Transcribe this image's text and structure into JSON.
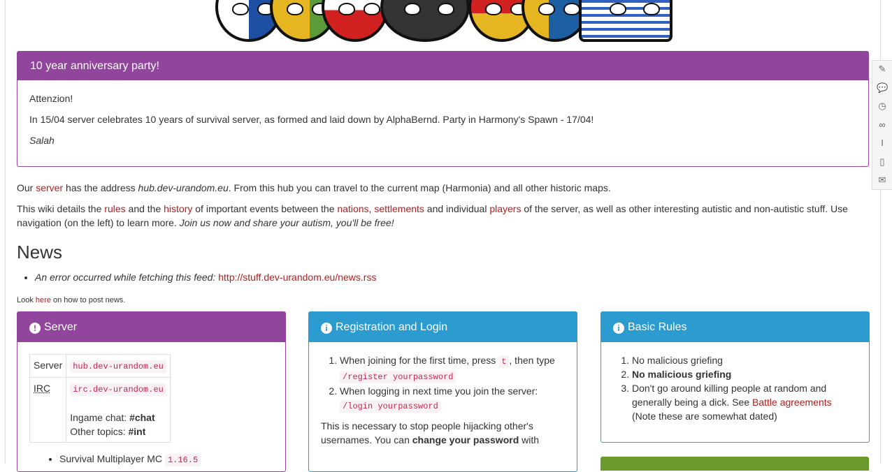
{
  "notice": {
    "title": "10 year anniversary party!",
    "line1": "Attenzion!",
    "line2": "In 15/04 server celebrates 10 years of survival server, as formed and laid down by AlphaBernd. Party in Harmony's Spawn - 17/04!",
    "signature": "Salah"
  },
  "intro": {
    "p1_a": "Our ",
    "p1_link": "server",
    "p1_b": " has the address ",
    "p1_address": "hub.dev-urandom.eu",
    "p1_c": ". From this hub you can travel to the current map (Harmonia) and all other historic maps.",
    "p2_a": "This wiki details the ",
    "p2_rules": "rules",
    "p2_b": " and the ",
    "p2_history": "history",
    "p2_c": " of important events between the ",
    "p2_nations": "nations",
    "p2_d": ", ",
    "p2_settlements": "settlements",
    "p2_e": " and individual ",
    "p2_players": "players",
    "p2_f": " of the server, as well as other interesting autistic and non-autistic stuff. Use navigation (on the left) to learn more. ",
    "p2_italic": "Join us now and share your autism, you'll be free!"
  },
  "news": {
    "heading": "News",
    "error_text": "An error occurred while fetching this feed: ",
    "feed_url": "http://stuff.dev-urandom.eu/news.rss",
    "howto_a": "Look ",
    "howto_link": "here",
    "howto_b": " on how to post news."
  },
  "server_box": {
    "title": "Server",
    "row1_label": "Server",
    "row1_value": "hub.dev-urandom.eu",
    "row2_label": "IRC",
    "row2_value": "irc.dev-urandom.eu",
    "ingame_label": "Ingame chat: ",
    "ingame_value": "#chat",
    "other_label": "Other topics: ",
    "other_value": "#int",
    "list_item": "Survival Multiplayer MC ",
    "version": "1.16.5"
  },
  "registration_box": {
    "title": "Registration and Login",
    "step1_a": "When joining for the first time, press ",
    "step1_key": "t",
    "step1_b": ", then type",
    "step1_cmd": "/register yourpassword",
    "step2": "When logging in next time you join the server:",
    "step2_cmd": "/login yourpassword",
    "note_a": "This is necessary to stop people hijacking other's usernames. You can ",
    "note_bold": "change your password",
    "note_b": " with"
  },
  "rules_box": {
    "title": "Basic Rules",
    "rule1": "No malicious griefing",
    "rule2": "No malicious griefing",
    "rule3_a": "Don't go around killing people at random and generally being a dick. See ",
    "rule3_link": "Battle agreements",
    "rule3_b": " (Note these are somewhat dated)"
  },
  "colors": {
    "purple": "#91459c",
    "blue": "#2c9bcf",
    "green": "#6a9a2b",
    "link": "#b31d1d"
  },
  "sidebar_icons": [
    "edit-icon",
    "comments-icon",
    "history-icon",
    "link-icon",
    "text-cursor-icon",
    "pdf-icon",
    "email-icon"
  ]
}
